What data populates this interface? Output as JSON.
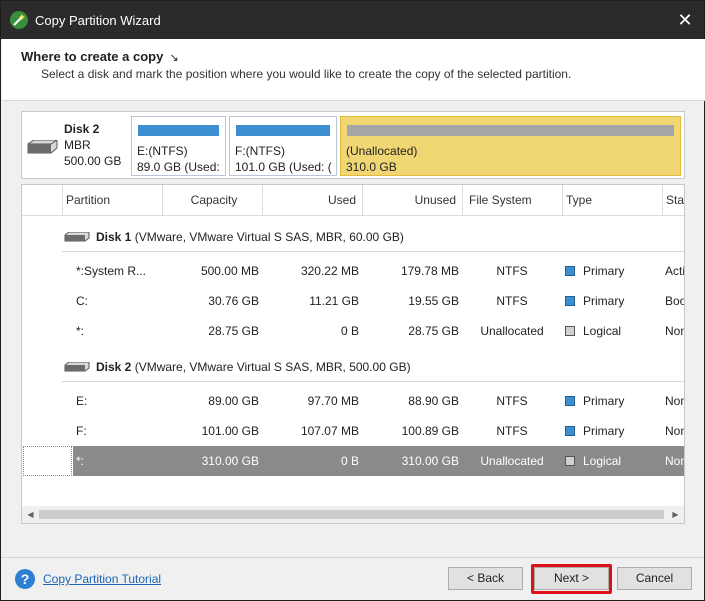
{
  "window": {
    "title": "Copy Partition Wizard"
  },
  "header": {
    "title": "Where to create a copy",
    "subtitle": "Select a disk and mark the position where you would like to create the copy of the selected partition."
  },
  "disk_map": {
    "name": "Disk 2",
    "type": "MBR",
    "size": "500.00 GB",
    "partitions": [
      {
        "label": "E:(NTFS)",
        "detail": "89.0 GB (Used:",
        "color": "#3d8fd4"
      },
      {
        "label": "F:(NTFS)",
        "detail": "101.0 GB (Used: (",
        "color": "#3d8fd4"
      },
      {
        "label": "(Unallocated)",
        "detail": "310.0 GB",
        "color": "#f0d774"
      }
    ]
  },
  "table": {
    "columns": [
      "Partition",
      "Capacity",
      "Used",
      "Unused",
      "File System",
      "Type",
      "Sta"
    ],
    "disks": [
      {
        "name": "Disk 1",
        "detail": "(VMware, VMware Virtual S SAS, MBR, 60.00 GB)",
        "rows": [
          {
            "partition": "*:System R...",
            "capacity": "500.00 MB",
            "used": "320.22 MB",
            "unused": "179.78 MB",
            "fs": "NTFS",
            "type": "Primary",
            "status": "Acti"
          },
          {
            "partition": "C:",
            "capacity": "30.76 GB",
            "used": "11.21 GB",
            "unused": "19.55 GB",
            "fs": "NTFS",
            "type": "Primary",
            "status": "Boo"
          },
          {
            "partition": "*:",
            "capacity": "28.75 GB",
            "used": "0 B",
            "unused": "28.75 GB",
            "fs": "Unallocated",
            "type": "Logical",
            "status": "Non"
          }
        ]
      },
      {
        "name": "Disk 2",
        "detail": "(VMware, VMware Virtual S SAS, MBR, 500.00 GB)",
        "rows": [
          {
            "partition": "E:",
            "capacity": "89.00 GB",
            "used": "97.70 MB",
            "unused": "88.90 GB",
            "fs": "NTFS",
            "type": "Primary",
            "status": "Non"
          },
          {
            "partition": "F:",
            "capacity": "101.00 GB",
            "used": "107.07 MB",
            "unused": "100.89 GB",
            "fs": "NTFS",
            "type": "Primary",
            "status": "Non"
          },
          {
            "partition": "*:",
            "capacity": "310.00 GB",
            "used": "0 B",
            "unused": "310.00 GB",
            "fs": "Unallocated",
            "type": "Logical",
            "status": "Non"
          }
        ]
      }
    ]
  },
  "footer": {
    "help_link": "Copy Partition Tutorial",
    "back_label": "< Back",
    "next_label": "Next >",
    "cancel_label": "Cancel"
  }
}
